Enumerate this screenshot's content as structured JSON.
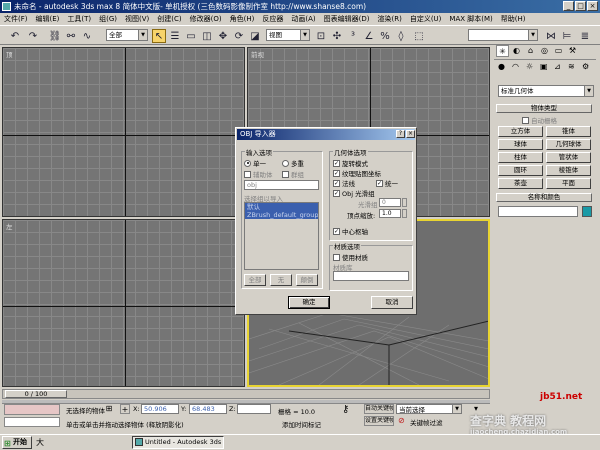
{
  "window": {
    "title": "未命名 - autodesk 3ds max 8  简体中文版- 单机授权 (三色数码影像制作室  http://www.shanse8.com)"
  },
  "menu": [
    "文件(F)",
    "编辑(E)",
    "工具(T)",
    "组(G)",
    "视图(V)",
    "创建(C)",
    "修改器(O)",
    "角色(H)",
    "反应器",
    "动画(A)",
    "图表编辑器(D)",
    "渲染(R)",
    "自定义(U)",
    "MAX 脚本(M)",
    "帮助(H)"
  ],
  "toolbar": {
    "selection_filter": "全部",
    "ref_coord": "视图"
  },
  "viewports": {
    "top": "顶",
    "front": "前视",
    "left": "左"
  },
  "command_panel": {
    "category": "标准几何体",
    "object_type_title": "物体类型",
    "autogrid": "自动栅格",
    "objects": [
      "立方体",
      "锥体",
      "球体",
      "几何球体",
      "柱体",
      "管状体",
      "圆环",
      "棱锥体",
      "茶壶",
      "平面"
    ],
    "name_color_title": "名称和颜色",
    "name_color_hex": "#1a9aa6"
  },
  "dialog": {
    "title": "OBJ 导入器",
    "help": "?",
    "close": "×",
    "input_group": "输入选项",
    "single": "单一",
    "multi": "多重",
    "helper": "辅助体",
    "group": "群组",
    "obj_field": "obj",
    "select_group_label": "选择组以导入",
    "groups": [
      "默认",
      "ZBrush_default_group"
    ],
    "btn_all": "全部",
    "btn_none": "无",
    "btn_invert": "颠倒",
    "geom_group": "几何体选项",
    "rotate_model": "旋转模式",
    "texcoords": "纹理贴图坐标",
    "normals": "法线",
    "unify": "统一",
    "smooth_group": "Obj 光滑组",
    "smooth_label": "光滑组",
    "smooth_value": "0",
    "vertex_scale_label": "顶点缩放:",
    "vertex_scale_value": "1.0",
    "center_pivot": "中心枢轴",
    "material_group": "材质选项",
    "use_material": "使用材质",
    "material_library": "材质库",
    "ok": "确定",
    "cancel": "取消"
  },
  "status": {
    "time_slider": "0 / 100",
    "selected": "无选择的物体",
    "x_label": "X:",
    "x_value": "50.906",
    "y_label": "Y:",
    "y_value": "68.483",
    "z_label": "Z:",
    "grid": "栅格 = 10.0",
    "auto_key": "自动关键帧",
    "set_key": "设置关键帧",
    "selection_set": "当前选择",
    "key_filters": "关键帧过滤",
    "prompt": "单击或单击并拖动选择物体 (释放阴影化)",
    "add_time_tag": "添加时间标记"
  },
  "taskbar": {
    "start": "开始",
    "task": "Untitled - Autodesk 3ds ..."
  },
  "watermark": {
    "line1": "查字典 教程网",
    "line2": "jb51.net",
    "line3": "jiaocheng.chazidian.com"
  }
}
